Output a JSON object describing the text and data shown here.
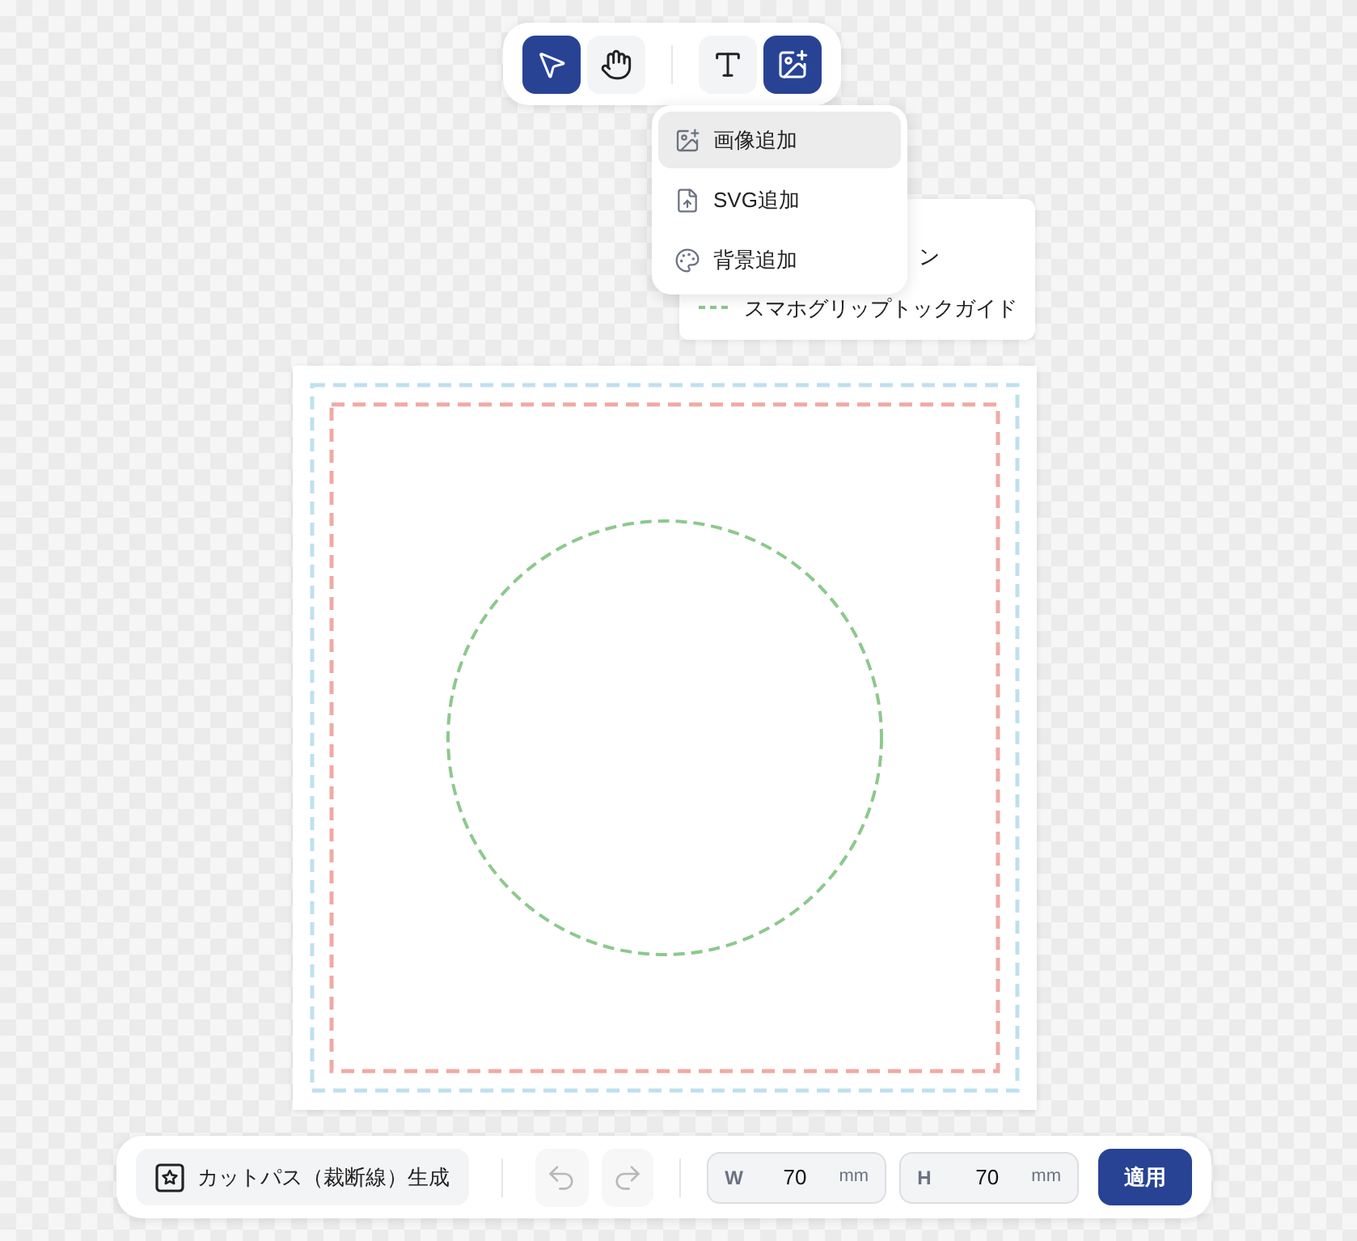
{
  "toolbar": {
    "tools": [
      {
        "kind": "select",
        "selected": true
      },
      {
        "kind": "hand",
        "selected": false
      },
      {
        "kind": "text",
        "selected": false
      },
      {
        "kind": "image",
        "selected": true
      }
    ]
  },
  "add_menu": {
    "items": [
      {
        "kind": "image",
        "label": "画像追加",
        "selected": true
      },
      {
        "kind": "svg",
        "label": "SVG追加",
        "selected": false
      },
      {
        "kind": "background",
        "label": "背景追加",
        "selected": false
      }
    ]
  },
  "legend": {
    "items": [
      {
        "label": "ン"
      },
      {
        "label": "スマホグリップトックガイド",
        "color": "#8cc98c"
      }
    ]
  },
  "canvas": {
    "guides": [
      {
        "kind": "rect",
        "color": "#bfe0ee"
      },
      {
        "kind": "rect",
        "color": "#f0aaa4"
      },
      {
        "kind": "circle",
        "color": "#8cc98c"
      }
    ]
  },
  "bottom_bar": {
    "cut_path_button": "カットパス（裁断線）生成",
    "undo": {
      "disabled": true
    },
    "redo": {
      "disabled": true
    },
    "width": {
      "label": "W",
      "value": "70",
      "unit": "mm"
    },
    "height": {
      "label": "H",
      "value": "70",
      "unit": "mm"
    },
    "apply_button": "適用"
  }
}
